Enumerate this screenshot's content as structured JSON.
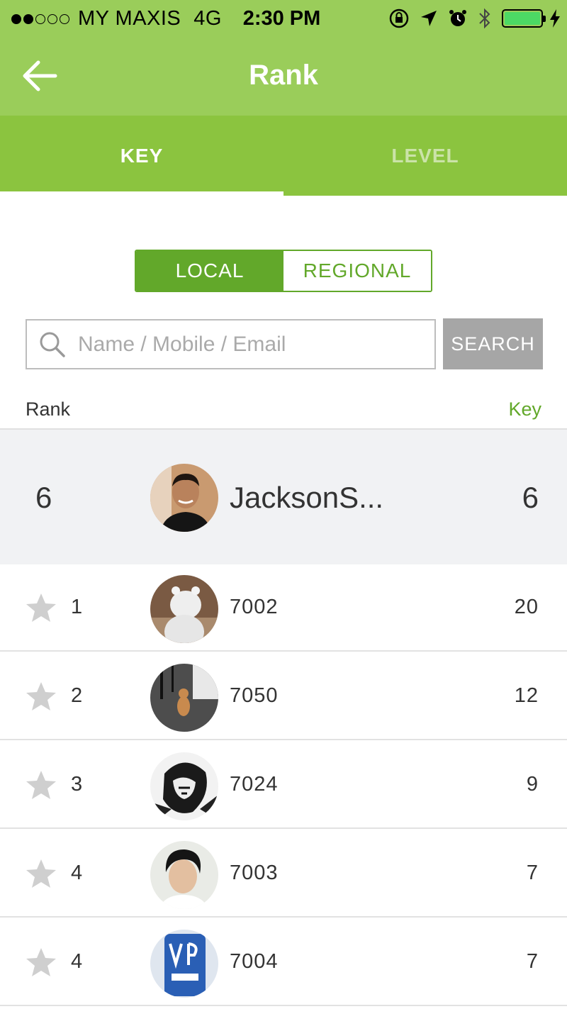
{
  "status_bar": {
    "carrier": "MY MAXIS",
    "network": "4G",
    "time": "2:30 PM",
    "signal_full": 2,
    "signal_total": 5,
    "battery_color": "#4cd964"
  },
  "header": {
    "title": "Rank",
    "back_icon": "arrow-left-icon",
    "color": "#9acd5a"
  },
  "tabs": [
    {
      "label": "KEY",
      "active": true
    },
    {
      "label": "LEVEL",
      "active": false
    }
  ],
  "segment": {
    "options": [
      {
        "label": "LOCAL",
        "selected": true
      },
      {
        "label": "REGIONAL",
        "selected": false
      }
    ],
    "accent": "#62a82a"
  },
  "search": {
    "placeholder": "Name / Mobile / Email",
    "value": "",
    "button_label": "SEARCH"
  },
  "columns": {
    "rank": "Rank",
    "key": "Key"
  },
  "current_user": {
    "rank": "6",
    "name": "JacksonS...",
    "key": "6"
  },
  "rows": [
    {
      "rank": "1",
      "name": "7002",
      "key": "20"
    },
    {
      "rank": "2",
      "name": "7050",
      "key": "12"
    },
    {
      "rank": "3",
      "name": "7024",
      "key": "9"
    },
    {
      "rank": "4",
      "name": "7003",
      "key": "7"
    },
    {
      "rank": "4",
      "name": "7004",
      "key": "7"
    }
  ]
}
